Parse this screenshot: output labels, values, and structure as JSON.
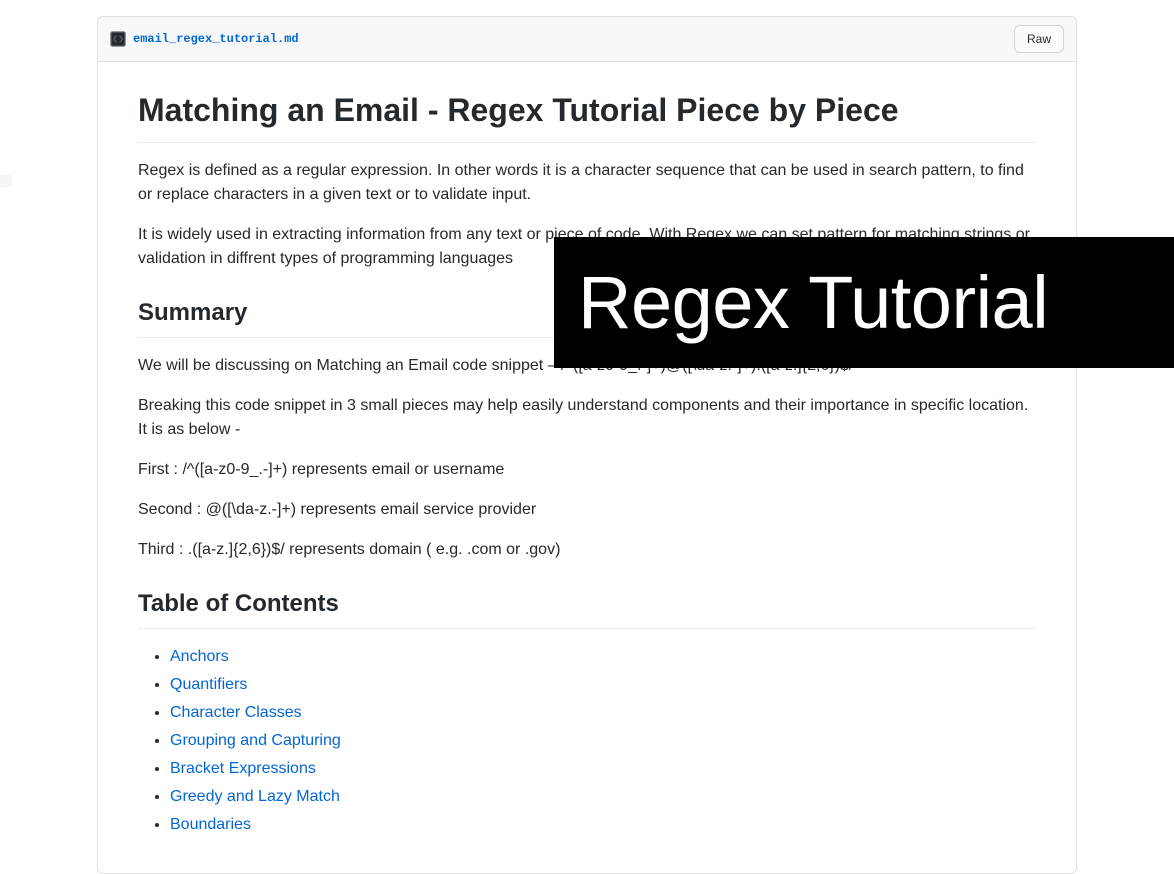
{
  "header": {
    "filename": "email_regex_tutorial.md",
    "raw_label": "Raw"
  },
  "article": {
    "title": "Matching an Email - Regex Tutorial Piece by Piece",
    "intro1": "Regex is defined as a regular expression. In other words it is a character sequence that can be used in search pattern, to find or replace characters in a given text or to validate input.",
    "intro2": "It is widely used in extracting information from any text or piece of code. With Regex we can set pattern for matching strings or validation in diffrent types of programming languages",
    "summary_heading": "Summary",
    "summary_p1": "We will be discussing on Matching an Email code snippet – /^([a-z0-9_.-]+)@([\\da-z.-]+).([a-z.]{2,6})$/",
    "summary_p2": "Breaking this code snippet in 3 small pieces may help easily understand components and their importance in specific location. It is as below -",
    "summary_p3": "First : /^([a-z0-9_.-]+) represents email or username",
    "summary_p4": "Second : @([\\da-z.-]+) represents email service provider",
    "summary_p5": "Third : .([a-z.]{2,6})$/ represents domain ( e.g. .com or .gov)",
    "toc_heading": "Table of Contents",
    "toc": [
      "Anchors",
      "Quantifiers",
      "Character Classes",
      "Grouping and Capturing",
      "Bracket Expressions",
      "Greedy and Lazy Match",
      "Boundaries"
    ]
  },
  "overlay_text": "Regex Tutorial"
}
